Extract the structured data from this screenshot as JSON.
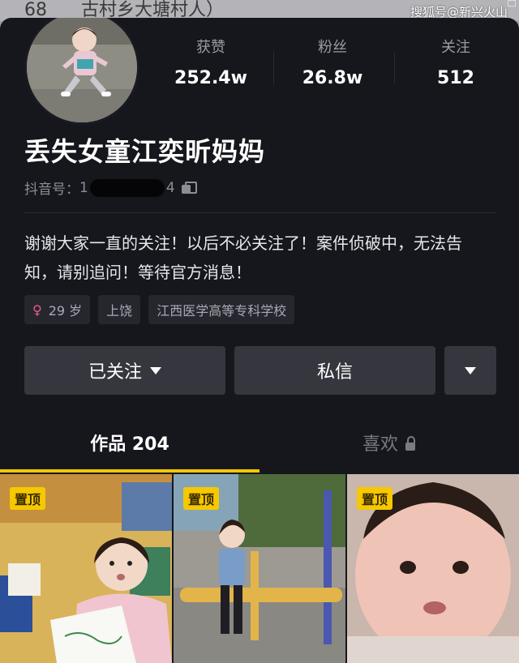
{
  "background_strip": {
    "text": "68",
    "text_2": "古村乡大塘村人）"
  },
  "watermark": "搜狐号@新兴火山",
  "profile": {
    "stats": [
      {
        "label": "获赞",
        "value": "252.4w"
      },
      {
        "label": "粉丝",
        "value": "26.8w"
      },
      {
        "label": "关注",
        "value": "512"
      }
    ],
    "name": "丢失女童江奕昕妈妈",
    "douyin_id_label": "抖音号：",
    "douyin_id_start": "1",
    "douyin_id_end": "4",
    "bio": "谢谢大家一直的关注！以后不必关注了！案件侦破中，无法告知，请别追问！等待官方消息！",
    "tags": {
      "age": "29 岁",
      "location": "上饶",
      "school": "江西医学高等专科学校"
    }
  },
  "actions": {
    "follow": "已关注",
    "message": "私信"
  },
  "tabs": {
    "works_label": "作品",
    "works_count": "204",
    "likes_label": "喜欢"
  },
  "videos": [
    {
      "badge": "置顶"
    },
    {
      "badge": "置顶"
    },
    {
      "badge": "置顶"
    }
  ],
  "colors": {
    "panel": "#16171d",
    "accent": "#f5c800",
    "button": "#36373e"
  }
}
